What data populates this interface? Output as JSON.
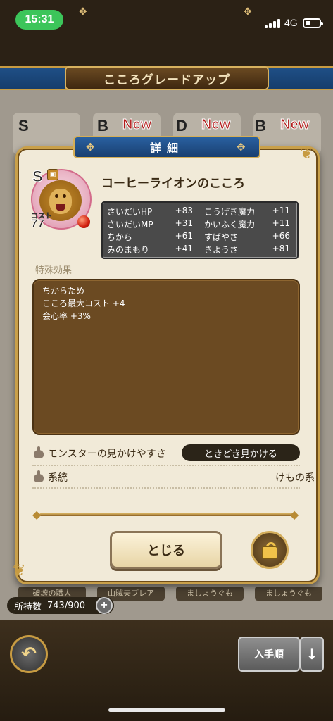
{
  "status_bar": {
    "time": "15:31",
    "network": "4G"
  },
  "screen": {
    "title": "こころグレードアップ"
  },
  "background_cards": [
    {
      "grade": "S",
      "badge": ""
    },
    {
      "grade": "B",
      "badge": "New"
    },
    {
      "grade": "D",
      "badge": "New"
    },
    {
      "grade": "B",
      "badge": "New"
    }
  ],
  "background_names": [
    "破壊の職人",
    "山賊夫ブレア",
    "ましょうぐも",
    "ましょうぐも"
  ],
  "owned": {
    "label": "所持数",
    "value": "743/900"
  },
  "sort_label": "入手順",
  "modal": {
    "title": "詳細",
    "monster": {
      "grade": "S",
      "cost_label": "コスト",
      "cost": "77",
      "name": "コーヒーライオンのこころ"
    },
    "stats": [
      {
        "label": "さいだいHP",
        "value": "+83"
      },
      {
        "label": "こうげき魔力",
        "value": "+11"
      },
      {
        "label": "さいだいMP",
        "value": "+31"
      },
      {
        "label": "かいふく魔力",
        "value": "+11"
      },
      {
        "label": "ちから",
        "value": "+61"
      },
      {
        "label": "すばやさ",
        "value": "+66"
      },
      {
        "label": "みのまもり",
        "value": "+41"
      },
      {
        "label": "きようさ",
        "value": "+81"
      }
    ],
    "special_label": "特殊効果",
    "effects": [
      "ちからため",
      "こころ最大コスト +4",
      "会心率 +3%"
    ],
    "visibility": {
      "label": "モンスターの見かけやすさ",
      "value": "ときどき見かける"
    },
    "lineage": {
      "label": "系統",
      "value": "けもの系"
    },
    "close_label": "とじる"
  }
}
